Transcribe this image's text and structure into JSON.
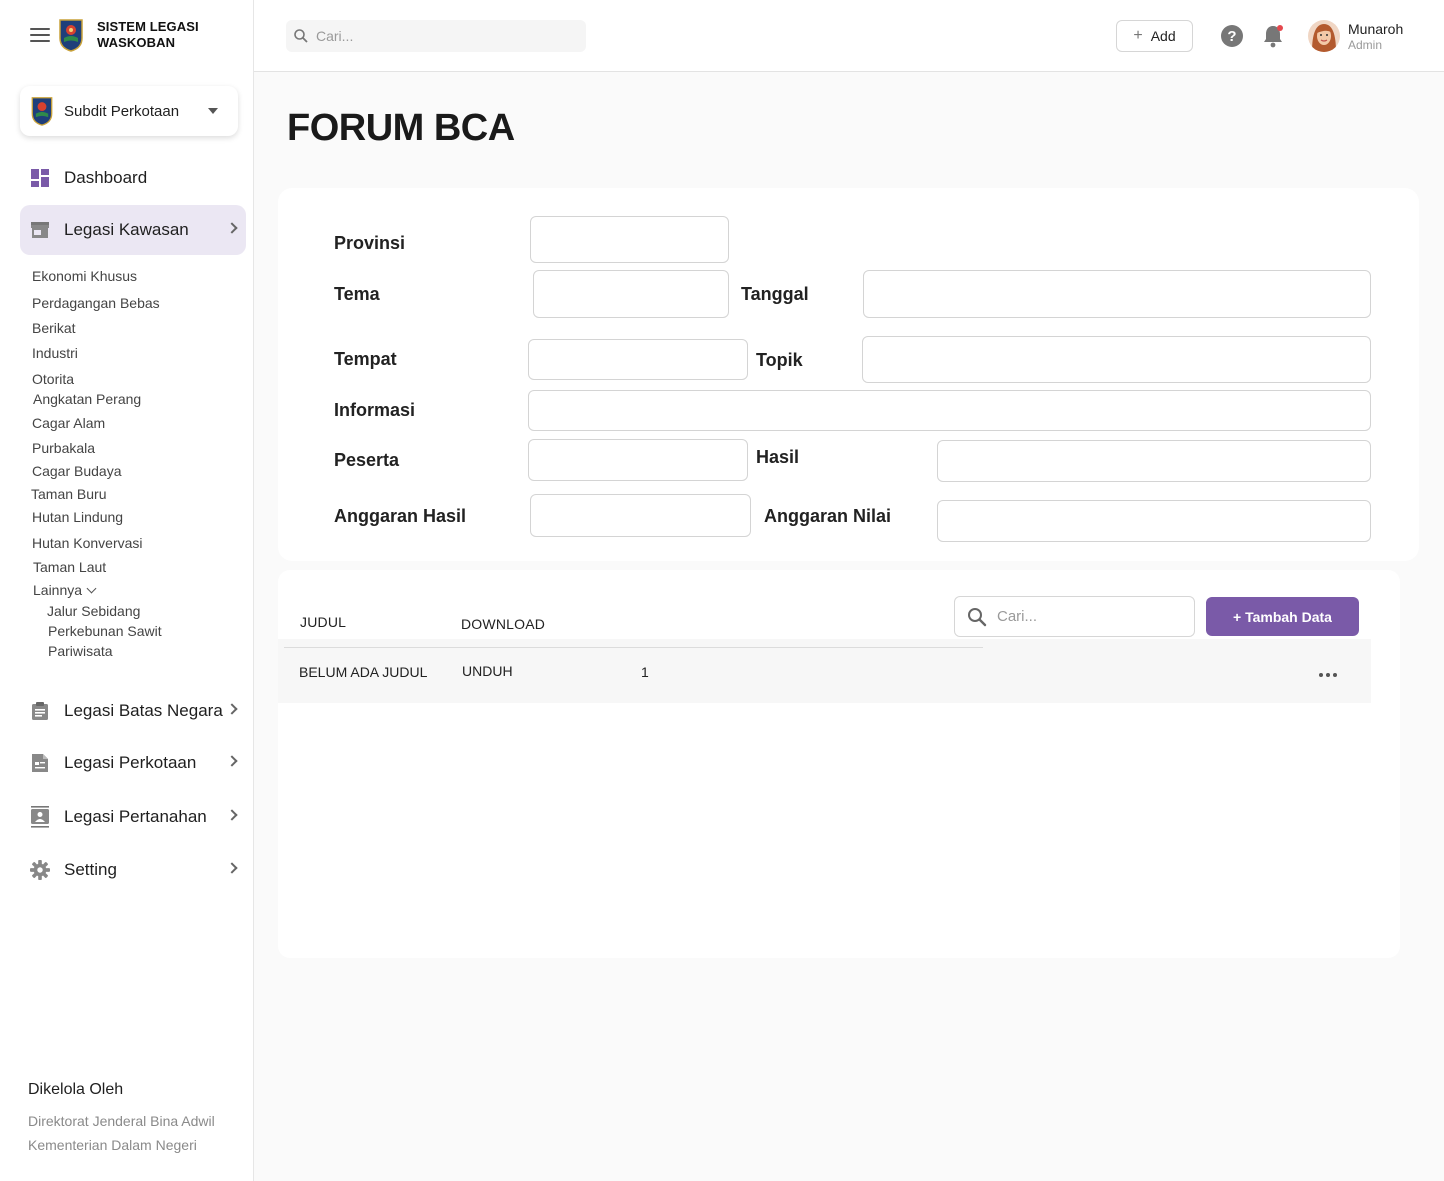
{
  "app": {
    "brand_line1": "SISTEM LEGASI",
    "brand_line2": "WASKOBAN",
    "org": "Subdit Perkotaan",
    "accent": "#7a5aa8",
    "active_bg": "#ebe7f3"
  },
  "sidebar": {
    "nav": [
      {
        "label": "Dashboard",
        "icon": "dashboard-icon"
      },
      {
        "label": "Legasi Kawasan",
        "icon": "store-icon"
      },
      {
        "label": "Legasi Batas Negara",
        "icon": "clipboard-icon"
      },
      {
        "label": "Legasi Perkotaan",
        "icon": "document-icon"
      },
      {
        "label": "Legasi Pertanahan",
        "icon": "contact-card-icon"
      },
      {
        "label": "Setting",
        "icon": "gear-icon"
      }
    ],
    "sub_items": [
      "Ekonomi Khusus",
      "Perdagangan Bebas",
      "Berikat",
      "Industri",
      "Otorita",
      "Angkatan Perang",
      "Cagar Alam",
      "Purbakala",
      "Cagar Budaya",
      "Taman Buru",
      "Hutan Lindung",
      "Hutan Konvervasi",
      "Taman Laut",
      "Lainnya"
    ],
    "nested_items": [
      "Jalur Sebidang",
      "Perkebunan Sawit",
      "Pariwisata"
    ],
    "footer": {
      "title": "Dikelola Oleh",
      "line1": "Direktorat Jenderal Bina Adwil",
      "line2": "Kementerian Dalam Negeri"
    }
  },
  "topbar": {
    "search_placeholder": "Cari...",
    "add_label": "Add",
    "user_name": "Munaroh",
    "user_role": "Admin",
    "notification_dot_color": "#e5484d"
  },
  "page": {
    "title": "FORUM BCA"
  },
  "form": {
    "provinsi": "Provinsi",
    "tema": "Tema",
    "tanggal": "Tanggal",
    "tempat": "Tempat",
    "topik": "Topik",
    "informasi": "Informasi",
    "peserta": "Peserta",
    "hasil": "Hasil",
    "anggaran_hasil": "Anggaran Hasil",
    "anggaran_nilai": "Anggaran Nilai"
  },
  "table": {
    "columns": [
      "JUDUL",
      "DOWNLOAD"
    ],
    "search_placeholder": "Cari...",
    "add_button": "+ Tambah Data",
    "rows": [
      {
        "judul": "BELUM ADA JUDUL",
        "download": "UNDUH",
        "count": "1"
      }
    ]
  }
}
